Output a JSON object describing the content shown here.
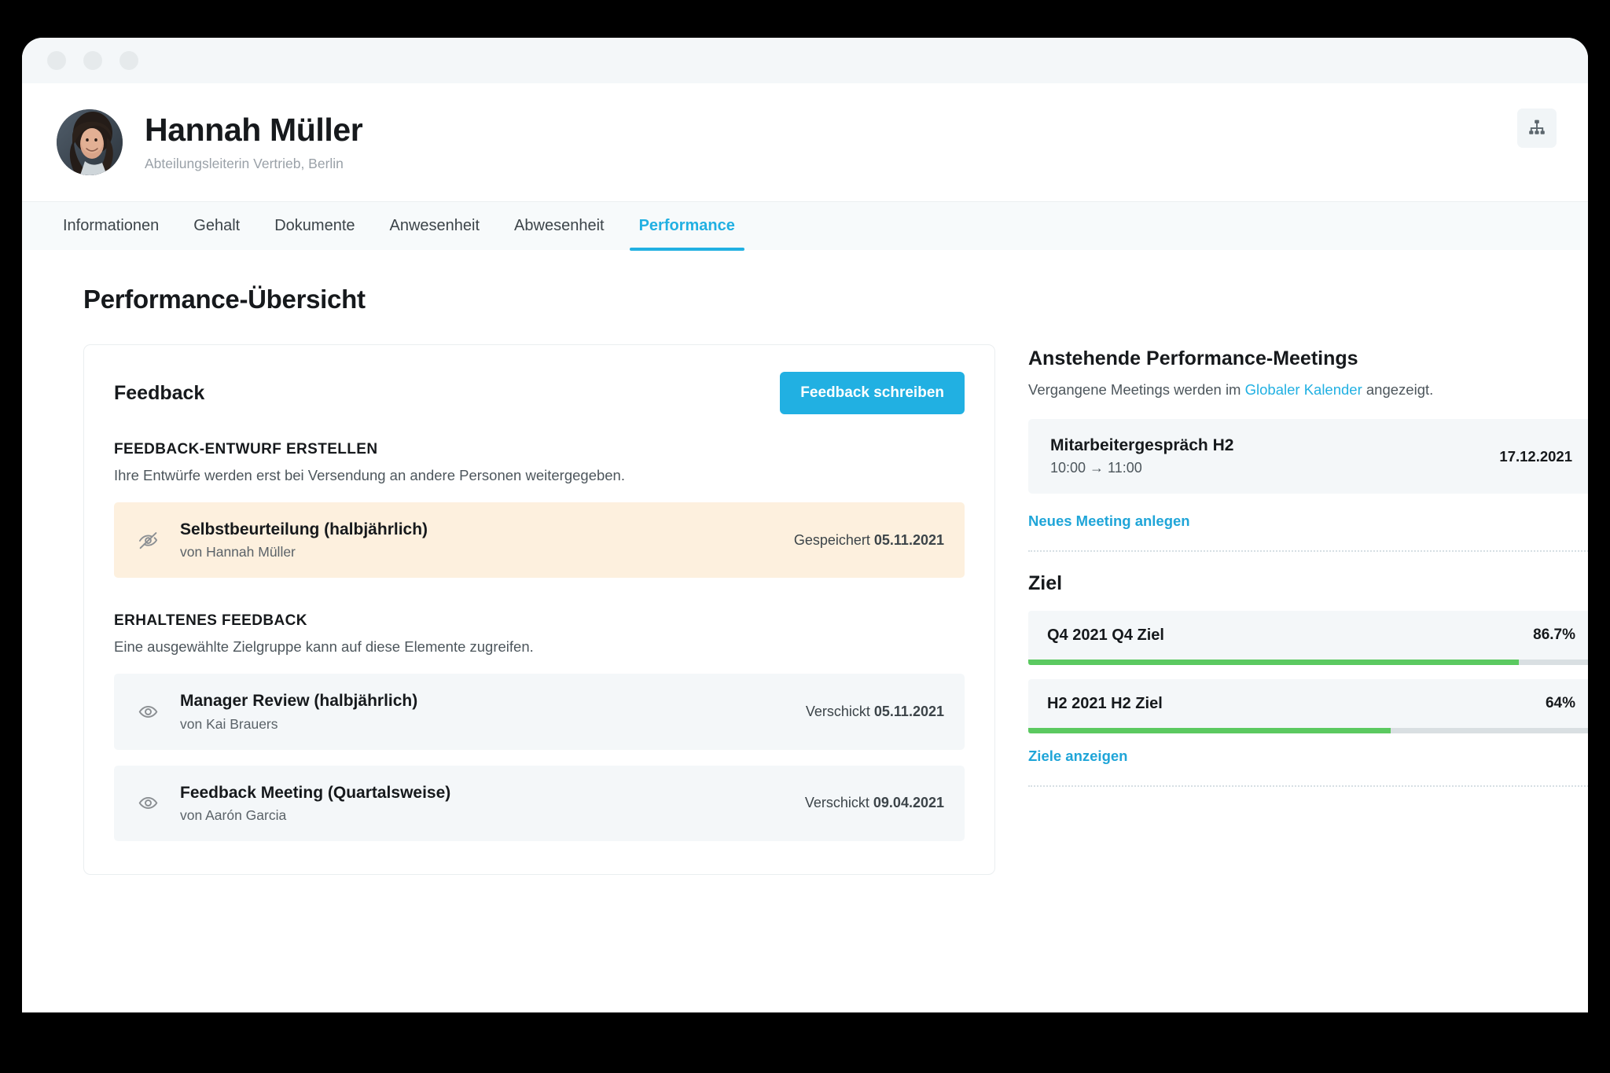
{
  "window": {
    "dots": [
      "minimize-dot",
      "maximize-dot",
      "close-dot"
    ]
  },
  "profile": {
    "name": "Hannah Müller",
    "role": "Abteilungsleiterin Vertrieb, Berlin",
    "org_chart_icon": "org-chart-icon"
  },
  "tabs": [
    {
      "label": "Informationen",
      "active": false
    },
    {
      "label": "Gehalt",
      "active": false
    },
    {
      "label": "Dokumente",
      "active": false
    },
    {
      "label": "Anwesenheit",
      "active": false
    },
    {
      "label": "Abwesenheit",
      "active": false
    },
    {
      "label": "Performance",
      "active": true
    }
  ],
  "page": {
    "title": "Performance-Übersicht"
  },
  "feedback": {
    "card_title": "Feedback",
    "write_button": "Feedback schreiben",
    "draft_section": {
      "label": "FEEDBACK-ENTWURF ERSTELLEN",
      "description": "Ihre Entwürfe werden erst bei Versendung an andere Personen weitergegeben.",
      "items": [
        {
          "icon": "eye-slash-icon",
          "title": "Selbstbeurteilung (halbjährlich)",
          "author": "von Hannah Müller",
          "status": "Gespeichert",
          "date": "05.11.2021"
        }
      ]
    },
    "received_section": {
      "label": "ERHALTENES FEEDBACK",
      "description": "Eine ausgewählte Zielgruppe kann auf diese Elemente zugreifen.",
      "items": [
        {
          "icon": "eye-icon",
          "title": "Manager Review (halbjährlich)",
          "author": "von Kai Brauers",
          "status": "Verschickt",
          "date": "05.11.2021"
        },
        {
          "icon": "eye-icon",
          "title": "Feedback Meeting (Quartalsweise)",
          "author": "von Aarón Garcia",
          "status": "Verschickt",
          "date": "09.04.2021"
        }
      ]
    }
  },
  "meetings": {
    "title": "Anstehende Performance-Meetings",
    "note_prefix": "Vergangene Meetings werden im ",
    "note_link": "Globaler Kalender",
    "note_suffix": " angezeigt.",
    "items": [
      {
        "name": "Mitarbeitergespräch H2",
        "time": "10:00 → 11:00",
        "date": "17.12.2021"
      }
    ],
    "create_link": "Neues Meeting anlegen"
  },
  "goals": {
    "title": "Ziel",
    "items": [
      {
        "name": "Q4 2021 Q4 Ziel",
        "percent_label": "86.7%",
        "percent": 86.7
      },
      {
        "name": "H2 2021 H2 Ziel",
        "percent_label": "64%",
        "percent": 64
      }
    ],
    "show_link": "Ziele anzeigen"
  },
  "colors": {
    "accent": "#21b0e2",
    "progress": "#5bc960",
    "draft_highlight": "#fdf0de",
    "row_bg": "#f4f7f9"
  }
}
